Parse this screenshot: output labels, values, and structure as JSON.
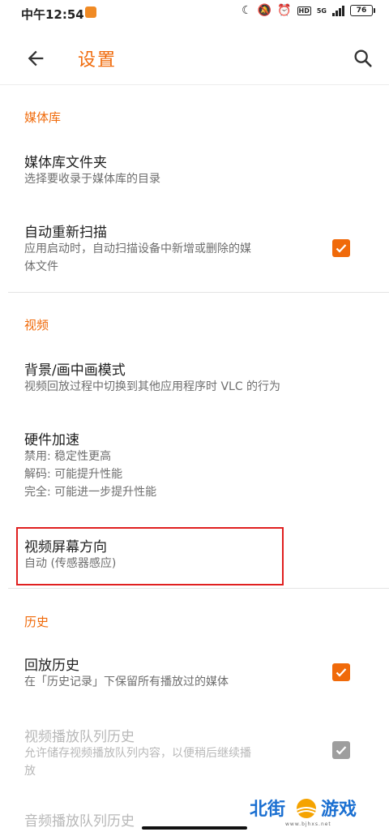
{
  "status_bar": {
    "time": "中午12:54",
    "network": "5G",
    "hd": "HD",
    "battery": "76"
  },
  "toolbar": {
    "title": "设置",
    "back_icon": "arrow-back-icon",
    "search_icon": "search-icon"
  },
  "sections": {
    "media_library": {
      "title": "媒体库",
      "folders": {
        "title": "媒体库文件夹",
        "subtitle": "选择要收录于媒体库的目录"
      },
      "auto_rescan": {
        "title": "自动重新扫描",
        "subtitle_line1": "应用启动时，自动扫描设备中新增或删除的媒",
        "subtitle_line2": "体文件",
        "checked": true
      }
    },
    "video": {
      "title": "视频",
      "pip": {
        "title": "背景/画中画模式",
        "subtitle": "视频回放过程中切换到其他应用程序时 VLC 的行为"
      },
      "hw_accel": {
        "title": "硬件加速",
        "line1": "禁用: 稳定性更高",
        "line2": "解码: 可能提升性能",
        "line3": "完全: 可能进一步提升性能"
      },
      "orientation": {
        "title": "视频屏幕方向",
        "subtitle": "自动 (传感器感应)"
      }
    },
    "history": {
      "title": "历史",
      "playback_history": {
        "title": "回放历史",
        "subtitle": "在「历史记录」下保留所有播放过的媒体",
        "checked": true
      },
      "video_queue": {
        "title": "视频播放队列历史",
        "subtitle_line1": "允许储存视频播放队列内容，以便稍后继续播",
        "subtitle_line2": "放",
        "checked": true,
        "enabled": false
      },
      "audio_queue": {
        "title": "音频播放队列历史"
      }
    }
  },
  "watermark": {
    "left": "北街",
    "right": "游戏",
    "url": "www.bjhxs.net"
  },
  "colors": {
    "accent": "#f06a0a",
    "highlight_border": "#e02020",
    "disabled": "#b8b8b8"
  }
}
